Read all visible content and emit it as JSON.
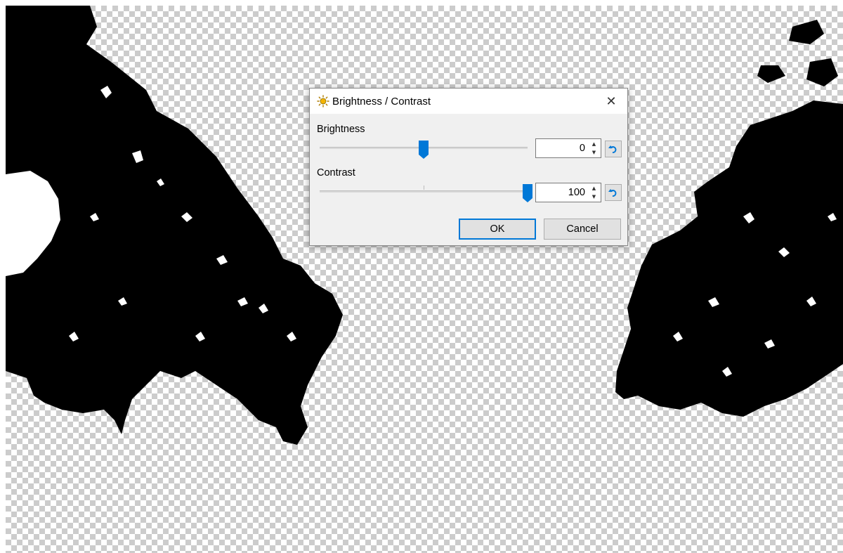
{
  "dialog": {
    "title": "Brightness / Contrast",
    "title_icon": "brightness-sun-icon",
    "close_glyph": "✕",
    "accent_color": "#0078d7",
    "brightness": {
      "label": "Brightness",
      "value": "0",
      "min": -100,
      "max": 100,
      "slider_fraction": 0.5
    },
    "contrast": {
      "label": "Contrast",
      "value": "100",
      "min": -100,
      "max": 100,
      "slider_fraction": 1.0
    },
    "ok_label": "OK",
    "cancel_label": "Cancel",
    "reset_icon": "reset-undo-icon"
  },
  "canvas": {
    "background": "transparency-checkerboard",
    "content_color": "#000000"
  }
}
